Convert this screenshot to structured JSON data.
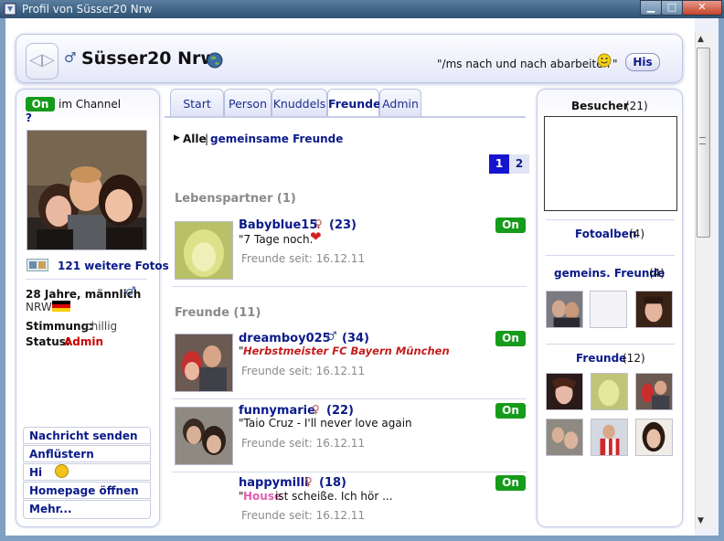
{
  "window": {
    "title": "Profil von Süsser20 Nrw"
  },
  "header": {
    "name": "Süsser20 Nrw",
    "status_message": "\"/ms nach und nach abarbeiten",
    "status_message_end": "\"",
    "his_button": "His"
  },
  "left": {
    "on_badge": "On",
    "channel_label": "im Channel",
    "question": "?",
    "more_photos": "121 weitere Fotos",
    "age_gender": "28 Jahre, männlich",
    "region": "NRW",
    "mood_label": "Stimmung:",
    "mood_value": "chillig",
    "status_label": "Status:",
    "status_value": "Admin",
    "menu": [
      "Nachricht senden",
      "Anflüstern",
      "Hi",
      "Homepage öffnen",
      "Mehr..."
    ]
  },
  "tabs": [
    "Start",
    "Person",
    "Knuddels",
    "Freunde",
    "Admin"
  ],
  "main": {
    "filter_all": "Alle",
    "filter_sep": "|",
    "filter_common": "gemeinsame Freunde",
    "pages": [
      "1",
      "2"
    ],
    "partner_heading": "Lebenspartner (1)",
    "friends_heading": "Freunde (11)",
    "friends": [
      {
        "name": "Babyblue15",
        "age": "(23)",
        "quote": "\"7 Tage noch.",
        "quote_highlight": "",
        "quote_rest": "",
        "since": "Freunde seit: 16.12.11",
        "status": "On"
      },
      {
        "name": "dreamboy025",
        "age": "(34)",
        "quote": "\"",
        "quote_highlight": "Herbstmeister FC Bayern München",
        "quote_rest": "",
        "since": "Freunde seit: 16.12.11",
        "status": "On"
      },
      {
        "name": "funnymarie",
        "age": "(22)",
        "quote": "\"Taio Cruz - I'll never love again",
        "quote_highlight": "",
        "quote_rest": "",
        "since": "Freunde seit: 16.12.11",
        "status": "On"
      },
      {
        "name": "happymilli",
        "age": "(18)",
        "quote": "\"",
        "quote_highlight": "House",
        "quote_rest": " ist scheiße. Ich hör ...",
        "since": "Freunde seit: 16.12.11",
        "status": "On"
      }
    ]
  },
  "right": {
    "visitors_label": "Besucher",
    "visitors_count": "(21)",
    "albums_label": "Fotoalben",
    "albums_count": "(4)",
    "common_label": "gemeins. Freunde",
    "common_count": "(4)",
    "friends_label": "Freunde",
    "friends_count": "(12)"
  },
  "colors": {
    "online_green": "#169b1b",
    "link_blue": "#0a1a8a",
    "admin_red": "#cc0000",
    "window_chrome": "#3d6282"
  }
}
